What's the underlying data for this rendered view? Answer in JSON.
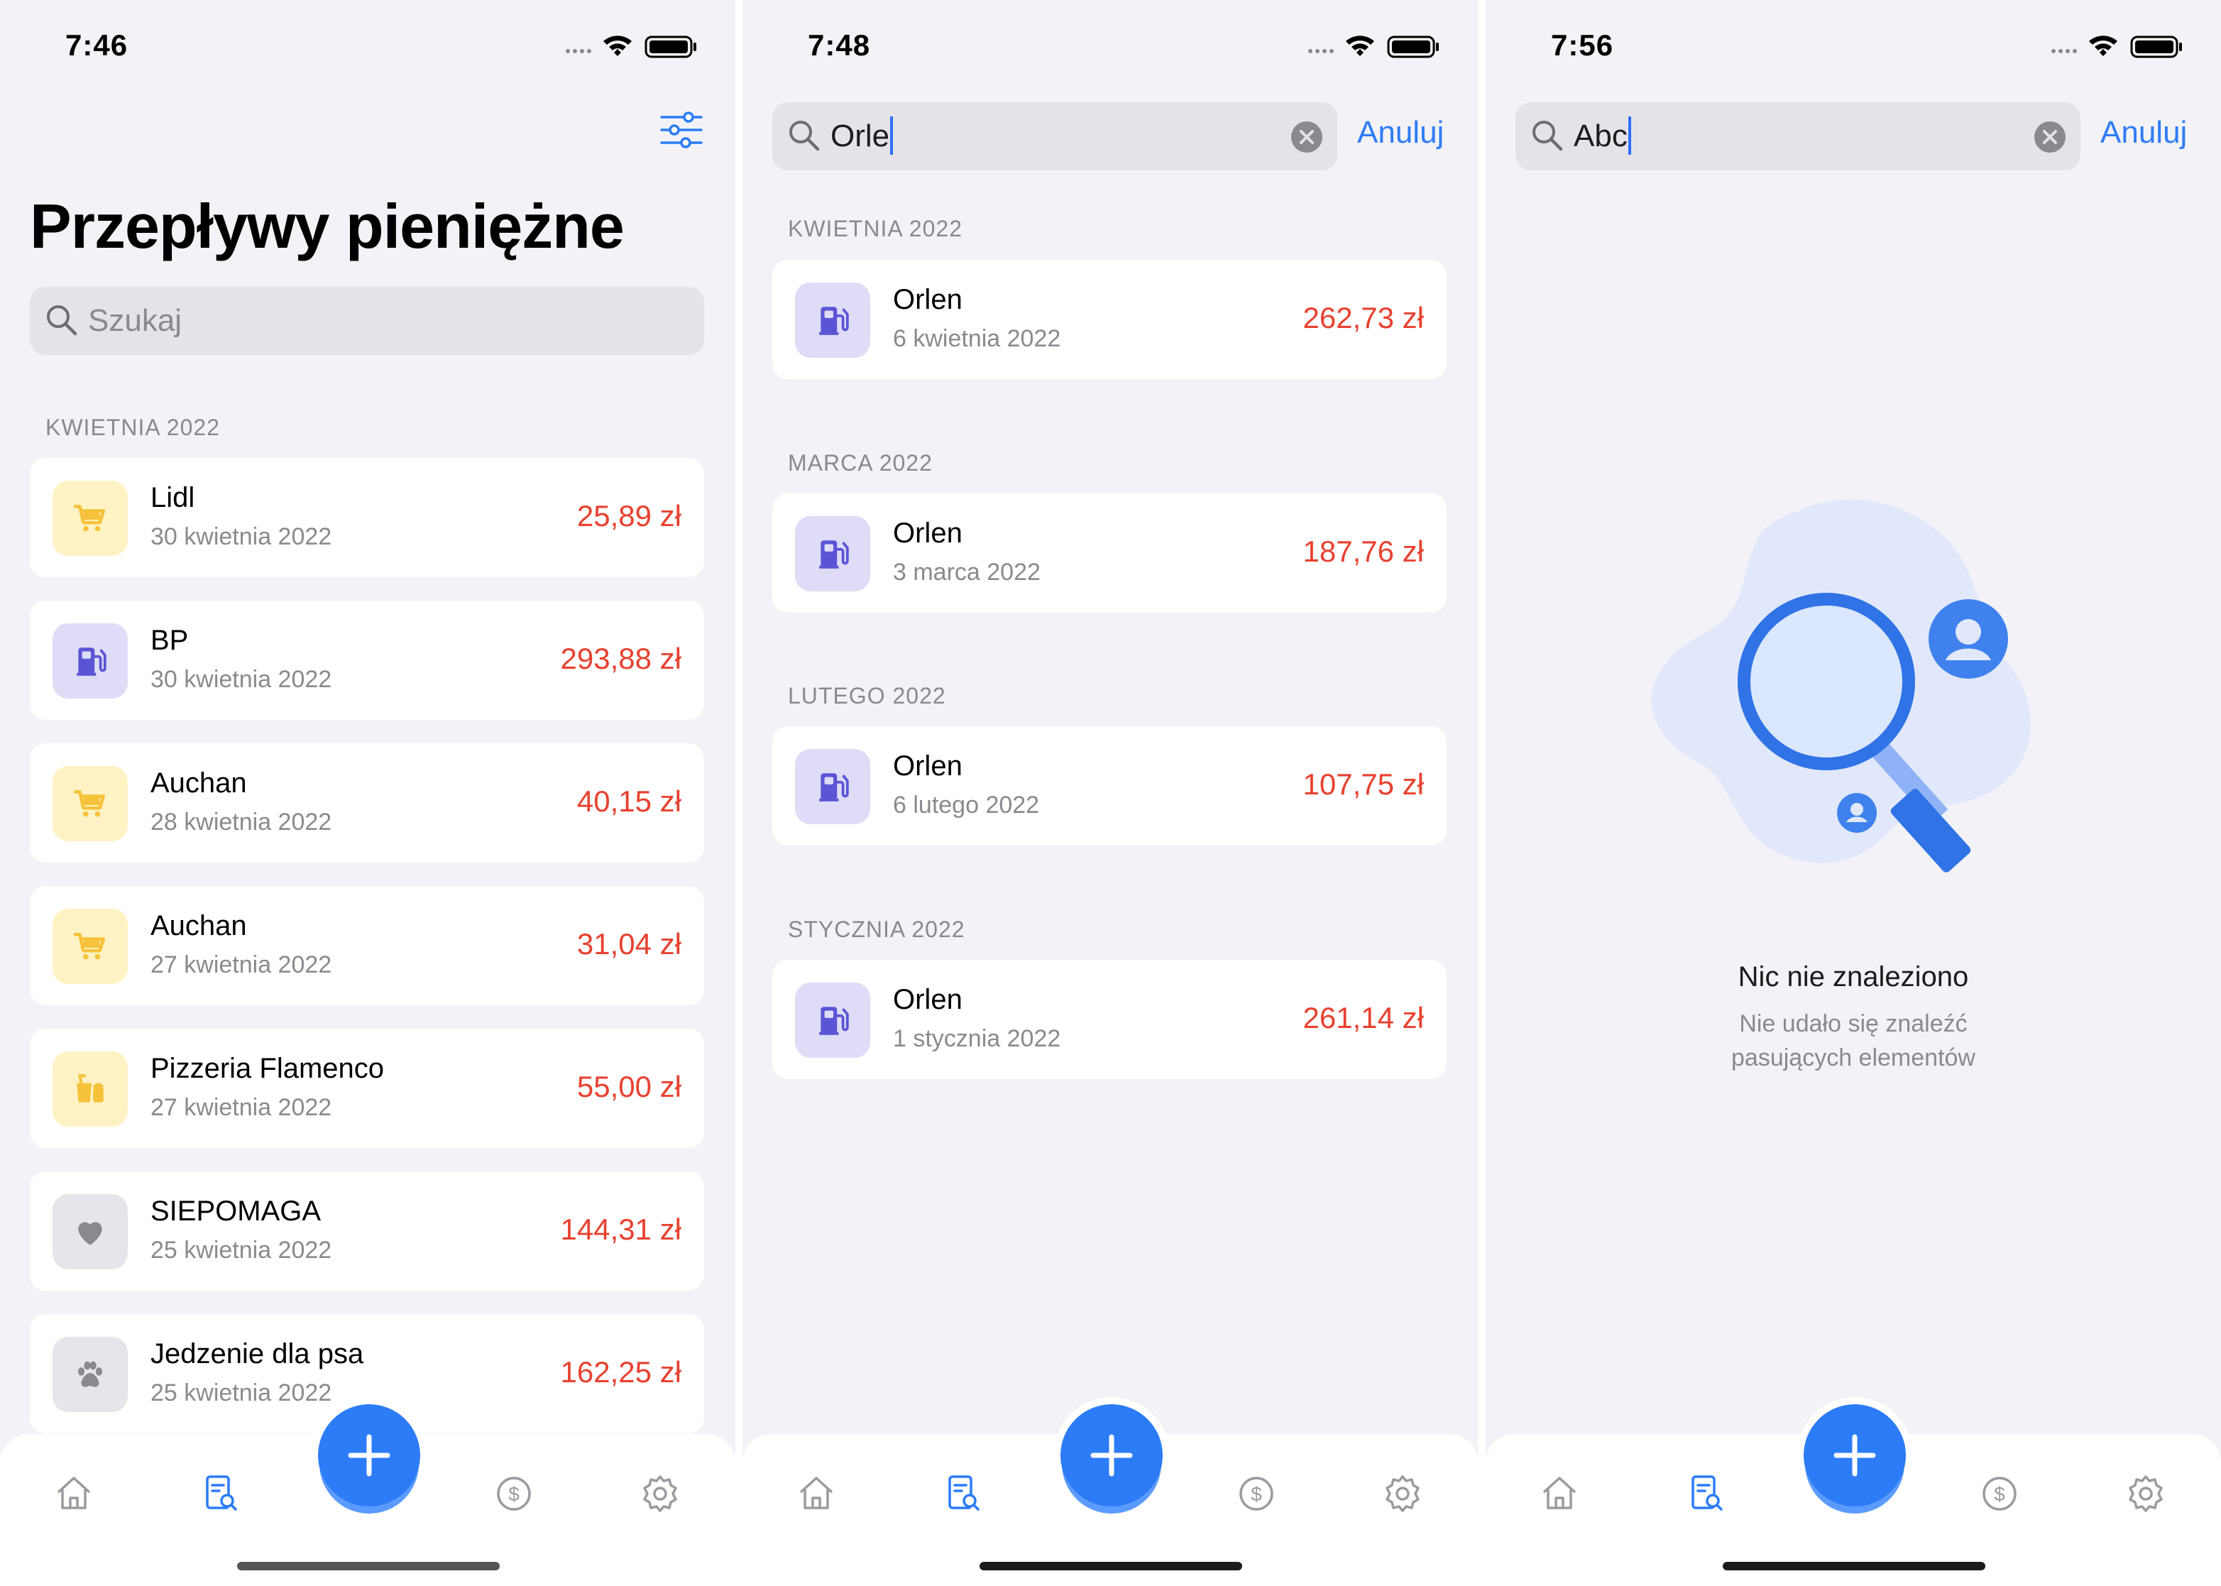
{
  "screens": [
    {
      "time": "7:46",
      "title": "Przepływy pieniężne",
      "search": {
        "placeholder": "Szukaj"
      },
      "sections": [
        {
          "label": "KWIETNIA 2022",
          "items": [
            {
              "name": "Lidl",
              "date": "30 kwietnia 2022",
              "amount": "25,89 zł",
              "icon": "shopping-cart-icon"
            },
            {
              "name": "BP",
              "date": "30 kwietnia 2022",
              "amount": "293,88 zł",
              "icon": "fuel-pump-icon"
            },
            {
              "name": "Auchan",
              "date": "28 kwietnia 2022",
              "amount": "40,15 zł",
              "icon": "shopping-cart-icon"
            },
            {
              "name": "Auchan",
              "date": "27 kwietnia 2022",
              "amount": "31,04 zł",
              "icon": "shopping-cart-icon"
            },
            {
              "name": "Pizzeria Flamenco",
              "date": "27 kwietnia 2022",
              "amount": "55,00 zł",
              "icon": "food-icon"
            },
            {
              "name": "SIEPOMAGA",
              "date": "25 kwietnia 2022",
              "amount": "144,31 zł",
              "icon": "heart-icon"
            },
            {
              "name": "Jedzenie dla psa",
              "date": "25 kwietnia 2022",
              "amount": "162,25 zł",
              "icon": "paw-icon"
            }
          ]
        }
      ]
    },
    {
      "time": "7:48",
      "search": {
        "value": "Orle"
      },
      "cancel": "Anuluj",
      "sections": [
        {
          "label": "KWIETNIA 2022",
          "items": [
            {
              "name": "Orlen",
              "date": "6 kwietnia 2022",
              "amount": "262,73 zł",
              "icon": "fuel-pump-icon"
            }
          ]
        },
        {
          "label": "MARCA 2022",
          "items": [
            {
              "name": "Orlen",
              "date": "3 marca 2022",
              "amount": "187,76 zł",
              "icon": "fuel-pump-icon"
            }
          ]
        },
        {
          "label": "LUTEGO 2022",
          "items": [
            {
              "name": "Orlen",
              "date": "6 lutego 2022",
              "amount": "107,75 zł",
              "icon": "fuel-pump-icon"
            }
          ]
        },
        {
          "label": "STYCZNIA 2022",
          "items": [
            {
              "name": "Orlen",
              "date": "1 stycznia 2022",
              "amount": "261,14 zł",
              "icon": "fuel-pump-icon"
            }
          ]
        }
      ]
    },
    {
      "time": "7:56",
      "search": {
        "value": "Abc"
      },
      "cancel": "Anuluj",
      "empty": {
        "title": "Nic nie znaleziono",
        "subtitle_line1": "Nie udało się znaleźć",
        "subtitle_line2": "pasujących elementów"
      }
    }
  ],
  "tabbar": [
    "home-icon",
    "transactions-icon",
    "add-button",
    "budget-icon",
    "settings-icon"
  ],
  "colors": {
    "accent": "#2C7CF7",
    "expense": "#E8412F",
    "background": "#F2F2F7"
  }
}
